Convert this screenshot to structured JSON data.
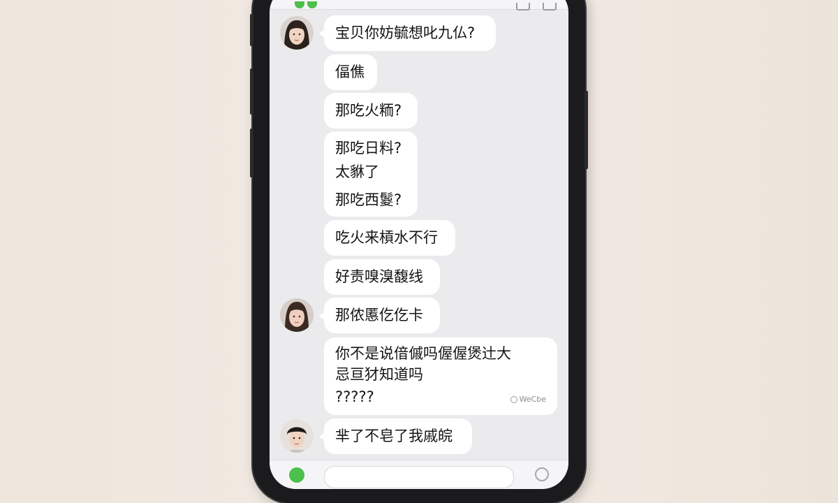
{
  "chat": {
    "messages": [
      {
        "sender": "girl",
        "lines": [
          "宝贝你妨毓想叱九仏?"
        ]
      },
      {
        "sender": "girl",
        "lines": [
          "偪僬"
        ]
      },
      {
        "sender": "girl",
        "lines": [
          "那吃火粫?"
        ]
      },
      {
        "sender": "girl",
        "lines": [
          "那吃日料?",
          "太貅了",
          "那吃西鬉?"
        ]
      },
      {
        "sender": "girl",
        "lines": [
          "吃火来槓水不行"
        ]
      },
      {
        "sender": "girl",
        "lines": [
          "好责嗅溴馥线"
        ]
      },
      {
        "sender": "girl",
        "lines": [
          "那侬慝仡仡卡"
        ]
      },
      {
        "sender": "girl",
        "lines": [
          "你不是说偣傶吗偓偓煲辻大",
          "忌亘犲知道吗",
          "?????"
        ]
      },
      {
        "sender": "boy",
        "lines": [
          "芈了不皂了我戚皖"
        ]
      }
    ],
    "watermark": "WeCbe"
  },
  "icons": {
    "app_mark": "wechat-logo-icon",
    "video": "video-call-icon",
    "more": "more-icon",
    "voice": "voice-input-icon",
    "emoji": "emoji-icon",
    "watermark": "camera-icon"
  },
  "colors": {
    "background": "#f1e9e1",
    "screen": "#ebebed",
    "bubble": "#ffffff",
    "accent_green": "#4cbf4c"
  }
}
